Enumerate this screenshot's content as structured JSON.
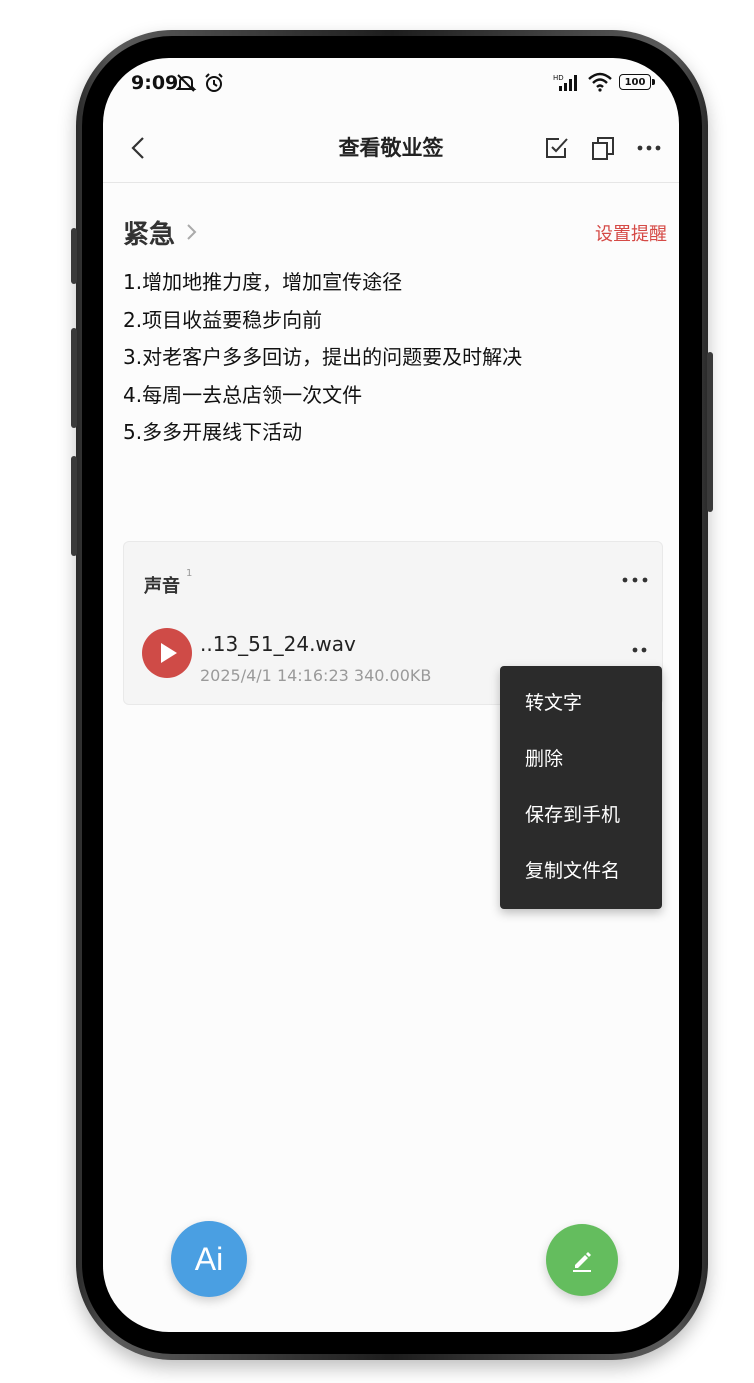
{
  "status_bar": {
    "time": "9:09",
    "left_icons": [
      "mute-notification-icon",
      "alarm-icon"
    ],
    "right_icons": [
      "hd-signal-icon",
      "wifi-icon",
      "battery-icon"
    ],
    "battery_level": "100"
  },
  "nav": {
    "title": "查看敬业签",
    "back_icon": "chevron-left-icon",
    "actions": [
      "checkbox-icon",
      "copy-icon",
      "more-icon"
    ]
  },
  "note": {
    "category": "紧急",
    "reminder_label": "设置提醒",
    "lines": [
      "1.增加地推力度，增加宣传途径",
      "2.项目收益要稳步向前",
      "3.对老客户多多回访，提出的问题要及时解决",
      "4.每周一去总店领一次文件",
      "5.多多开展线下活动"
    ]
  },
  "attachments": {
    "title": "声音",
    "count": "1",
    "item": {
      "file_name": "..13_51_24.wav",
      "meta": "2025/4/1 14:16:23 340.00KB"
    }
  },
  "context_menu": {
    "items": [
      "转文字",
      "删除",
      "保存到手机",
      "复制文件名"
    ]
  },
  "fab": {
    "ai_label": "Ai",
    "edit_icon": "pen-icon"
  },
  "colors": {
    "accent_red": "#d54a46",
    "play_red": "#cf4b47",
    "fab_blue": "#4a9fe2",
    "fab_green": "#64bd5e",
    "menu_bg": "#2b2b2b"
  }
}
